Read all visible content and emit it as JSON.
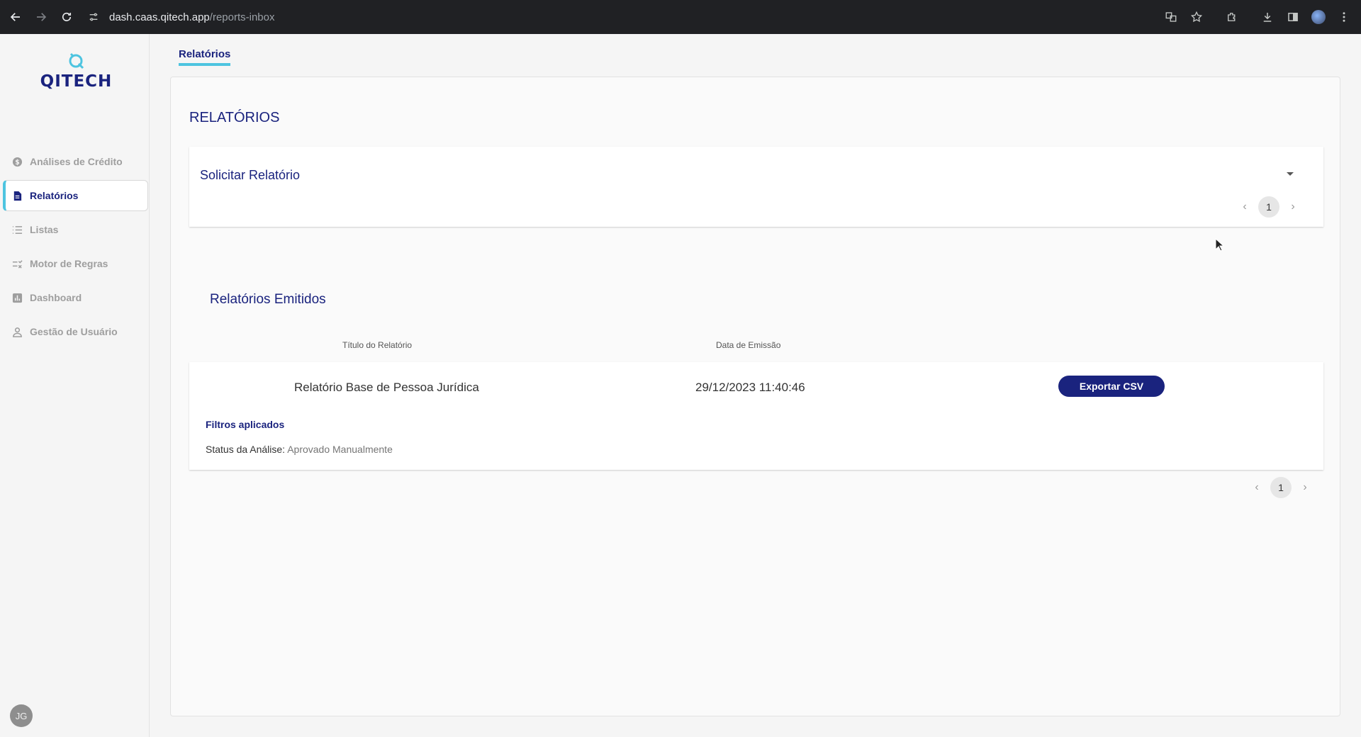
{
  "browser": {
    "url_host": "dash.caas.qitech.app",
    "url_path": "/reports-inbox"
  },
  "sidebar": {
    "logo_text": "QITECH",
    "items": [
      {
        "label": "Análises de Crédito",
        "icon": "dollar-circle-icon"
      },
      {
        "label": "Relatórios",
        "icon": "report-file-icon"
      },
      {
        "label": "Listas",
        "icon": "list-icon"
      },
      {
        "label": "Motor de Regras",
        "icon": "rules-icon"
      },
      {
        "label": "Dashboard",
        "icon": "bar-chart-icon"
      },
      {
        "label": "Gestão de Usuário",
        "icon": "user-icon"
      }
    ],
    "avatar_initials": "JG"
  },
  "tabs": [
    {
      "label": "Relatórios"
    }
  ],
  "page": {
    "title": "RELATÓRIOS",
    "request_card": {
      "title": "Solicitar Relatório",
      "page": "1"
    },
    "issued": {
      "title": "Relatórios Emitidos",
      "columns": [
        "Título do Relatório",
        "Data de Emissão"
      ],
      "rows": [
        {
          "title": "Relatório Base de Pessoa Jurídica",
          "date": "29/12/2023 11:40:46",
          "action": "Exportar CSV",
          "filters_label": "Filtros aplicados",
          "filter_key": "Status da Análise:",
          "filter_value": "Aprovado Manualmente"
        }
      ],
      "page": "1"
    }
  },
  "colors": {
    "brand_navy": "#1a237e",
    "accent_cyan": "#4dc4e0"
  }
}
